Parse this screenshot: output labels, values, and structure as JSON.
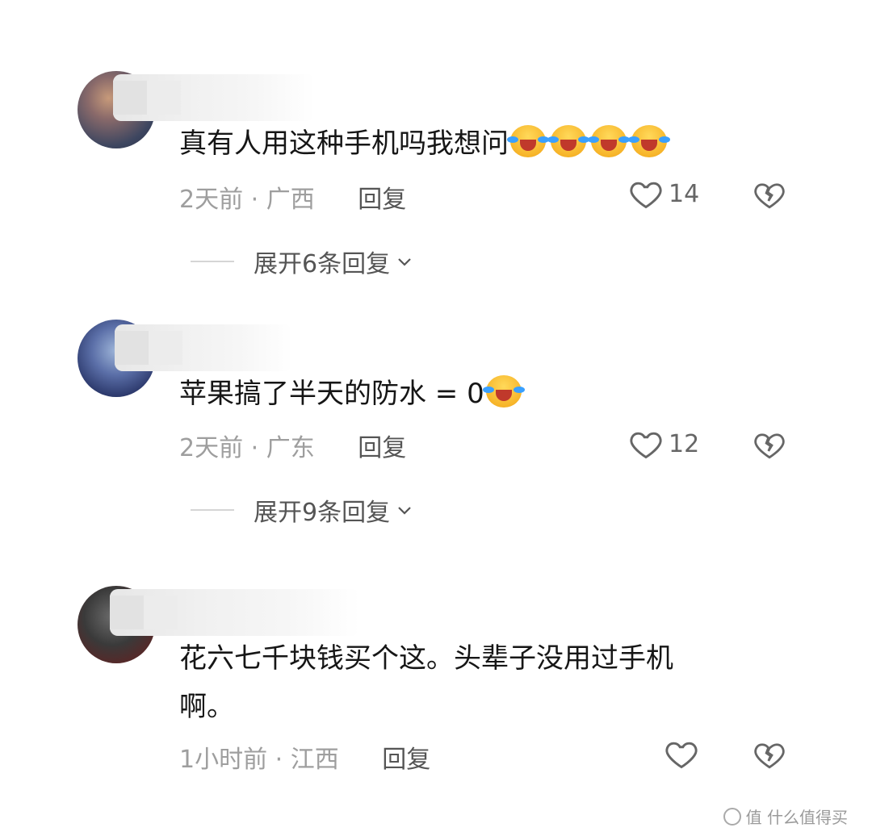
{
  "comments": [
    {
      "text": "真有人用这种手机吗我想问",
      "emoji_count": 4,
      "time": "2天前",
      "location": "广西",
      "separator": "·",
      "reply_label": "回复",
      "like_count": "14",
      "expand_label": "展开6条回复"
    },
    {
      "text": "苹果搞了半天的防水 = 0",
      "emoji_count": 1,
      "time": "2天前",
      "location": "广东",
      "separator": "·",
      "reply_label": "回复",
      "like_count": "12",
      "expand_label": "展开9条回复"
    },
    {
      "text_line1": "花六七千块钱买个这。头辈子没用过手机",
      "text_line2": "啊。",
      "time": "1小时前",
      "location": "江西",
      "separator": "·",
      "reply_label": "回复",
      "like_count": ""
    }
  ],
  "watermark": "值 什么值得买",
  "icons": {
    "emoji": "laughing-crying-emoji-icon",
    "like": "heart-outline-icon",
    "dislike": "broken-heart-icon",
    "expand": "chevron-down-icon"
  },
  "colors": {
    "text": "#161616",
    "meta": "#9e9e9e",
    "reply": "#555555"
  }
}
